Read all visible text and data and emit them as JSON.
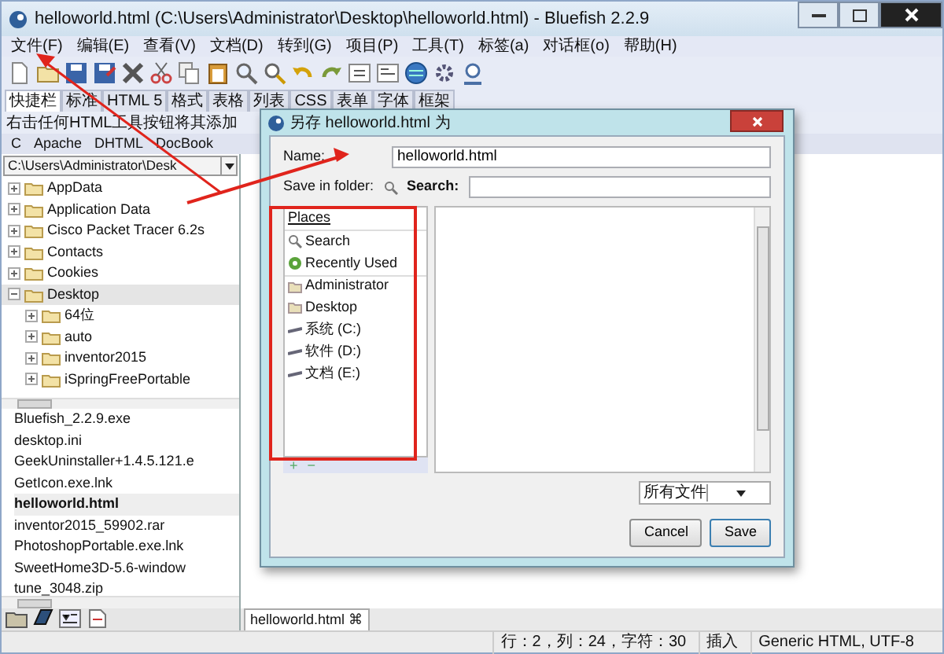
{
  "window": {
    "title": "helloworld.html (C:\\Users\\Administrator\\Desktop\\helloworld.html) - Bluefish 2.2.9"
  },
  "menu": [
    "文件(F)",
    "编辑(E)",
    "查看(V)",
    "文档(D)",
    "转到(G)",
    "项目(P)",
    "工具(T)",
    "标签(a)",
    "对话框(o)",
    "帮助(H)"
  ],
  "toolbar_tabs": [
    {
      "label": "快捷栏",
      "selected": true
    },
    {
      "label": "标准",
      "selected": false
    },
    {
      "label": "HTML 5",
      "selected": false
    },
    {
      "label": "格式",
      "selected": false
    },
    {
      "label": "表格",
      "selected": false
    },
    {
      "label": "列表",
      "selected": false
    },
    {
      "label": "CSS",
      "selected": false
    },
    {
      "label": "表单",
      "selected": false
    },
    {
      "label": "字体",
      "selected": false
    },
    {
      "label": "框架",
      "selected": false
    }
  ],
  "quickbar_hint": "右击任何HTML工具按钮将其添加",
  "language_tabs": [
    "C",
    "Apache",
    "DHTML",
    "DocBook"
  ],
  "sidebar": {
    "path": "C:\\Users\\Administrator\\Desk",
    "tree": [
      {
        "label": "AppData",
        "expanded": false,
        "selected": false
      },
      {
        "label": "Application Data",
        "expanded": false,
        "selected": false
      },
      {
        "label": "Cisco Packet Tracer 6.2s",
        "expanded": false,
        "selected": false
      },
      {
        "label": "Contacts",
        "expanded": false,
        "selected": false
      },
      {
        "label": "Cookies",
        "expanded": false,
        "selected": false
      },
      {
        "label": "Desktop",
        "expanded": true,
        "selected": true,
        "children": [
          {
            "label": "64位",
            "expanded": false,
            "selected": false
          },
          {
            "label": "auto",
            "expanded": false,
            "selected": false
          },
          {
            "label": "inventor2015",
            "expanded": false,
            "selected": false
          },
          {
            "label": "iSpringFreePortable",
            "expanded": false,
            "selected": false
          }
        ]
      }
    ],
    "files": [
      {
        "label": "Bluefish_2.2.9.exe",
        "selected": false
      },
      {
        "label": "desktop.ini",
        "selected": false
      },
      {
        "label": "GeekUninstaller+1.4.5.121.e",
        "selected": false
      },
      {
        "label": "GetIcon.exe.lnk",
        "selected": false
      },
      {
        "label": "helloworld.html",
        "selected": true
      },
      {
        "label": "inventor2015_59902.rar",
        "selected": false
      },
      {
        "label": "PhotoshopPortable.exe.lnk",
        "selected": false
      },
      {
        "label": "SweetHome3D-5.6-window",
        "selected": false
      },
      {
        "label": "tune_3048.zip",
        "selected": false
      }
    ]
  },
  "document_tab": {
    "label": "helloworld.html",
    "close": "⌘"
  },
  "status_bar": {
    "position": "行：2，列：24，字符：30",
    "mode": "插入",
    "encoding": "Generic HTML, UTF-8"
  },
  "dialog": {
    "title": "另存 helloworld.html 为",
    "name_label": "Name:",
    "name_value": "helloworld.html",
    "save_in_label": "Save in folder:",
    "search_label": "Search:",
    "places_title": "Places",
    "places": [
      {
        "kind": "search",
        "label": "Search"
      },
      {
        "kind": "recent",
        "label": "Recently Used"
      },
      {
        "kind": "folder",
        "label": "Administrator"
      },
      {
        "kind": "folder",
        "label": "Desktop"
      },
      {
        "kind": "drive",
        "label": "系统 (C:)"
      },
      {
        "kind": "drive",
        "label": "软件 (D:)"
      },
      {
        "kind": "drive",
        "label": "文档 (E:)"
      }
    ],
    "add_label": "+",
    "remove_label": "−",
    "filter": "所有文件",
    "buttons": [
      {
        "kind": "cancel",
        "label": "Cancel"
      },
      {
        "kind": "save",
        "label": "Save"
      }
    ]
  }
}
